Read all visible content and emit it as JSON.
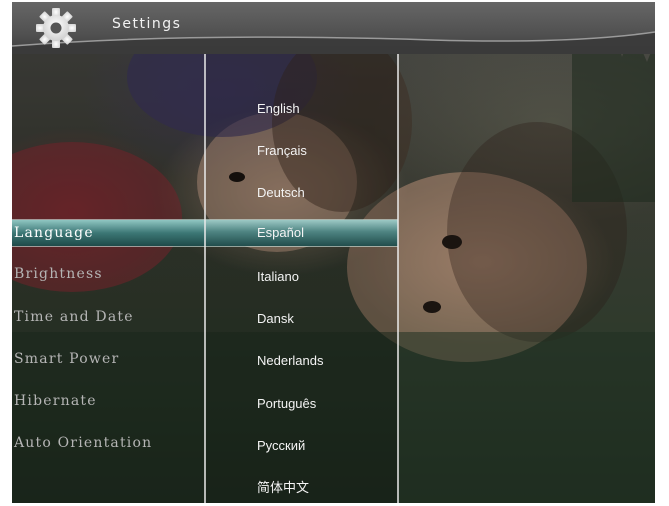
{
  "header": {
    "title": "Settings",
    "icon": "gear-icon"
  },
  "menu": {
    "items": [
      {
        "label": "Language",
        "selected": true
      },
      {
        "label": "Brightness",
        "selected": false
      },
      {
        "label": "Time and Date",
        "selected": false
      },
      {
        "label": "Smart Power",
        "selected": false
      },
      {
        "label": "Hibernate",
        "selected": false
      },
      {
        "label": "Auto Orientation",
        "selected": false
      }
    ]
  },
  "languages": {
    "items": [
      {
        "label": "English",
        "selected": false
      },
      {
        "label": "Français",
        "selected": false
      },
      {
        "label": "Deutsch",
        "selected": false
      },
      {
        "label": "Español",
        "selected": true
      },
      {
        "label": "Italiano",
        "selected": false
      },
      {
        "label": "Dansk",
        "selected": false
      },
      {
        "label": "Nederlands",
        "selected": false
      },
      {
        "label": "Português",
        "selected": false
      },
      {
        "label": "Русский",
        "selected": false
      },
      {
        "label": "简体中文",
        "selected": false
      }
    ]
  },
  "colors": {
    "highlight": "#3c7775",
    "header": "#555555",
    "text": "#f4f4f4",
    "menu_text": "#b5b5b5"
  }
}
